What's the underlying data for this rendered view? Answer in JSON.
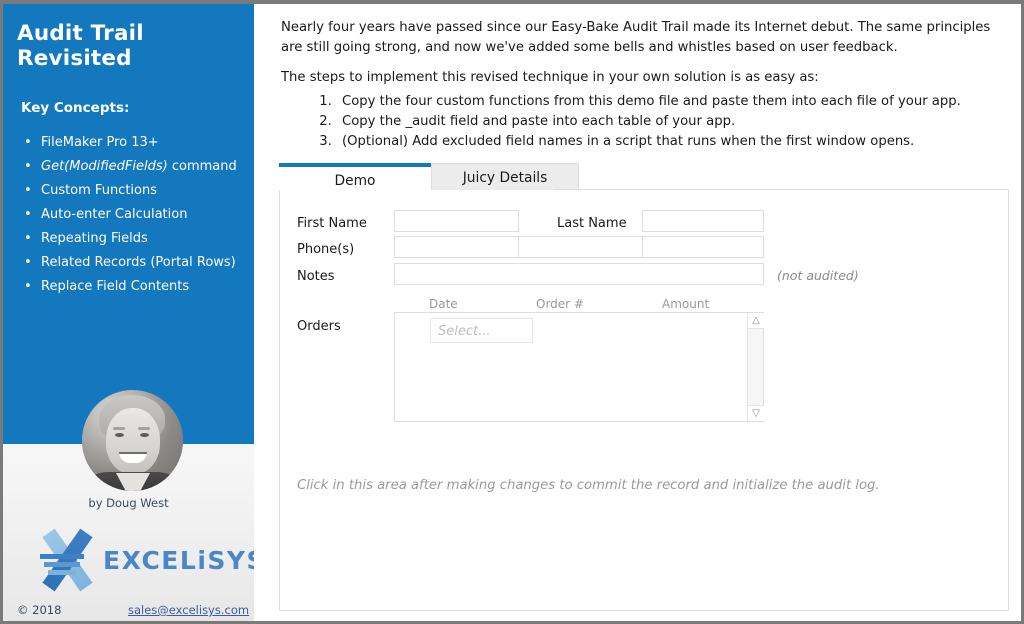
{
  "sidebar": {
    "title": "Audit Trail Revisited",
    "key_concepts_heading": "Key Concepts:",
    "concepts": [
      {
        "text": "FileMaker Pro 13+",
        "italic": ""
      },
      {
        "text": " command",
        "italic": "Get(ModifiedFields)"
      },
      {
        "text": "Custom Functions",
        "italic": ""
      },
      {
        "text": "Auto-enter Calculation",
        "italic": ""
      },
      {
        "text": "Repeating Fields",
        "italic": ""
      },
      {
        "text": "Related Records (Portal Rows)",
        "italic": ""
      },
      {
        "text": "Replace Field Contents",
        "italic": ""
      }
    ],
    "byline": "by Doug West",
    "logo_text": "EXCELiSYS",
    "copyright": "© 2018",
    "email": "sales@excelisys.com",
    "accent_color": "#1478be"
  },
  "main": {
    "intro_paragraph": "Nearly four years have passed since our Easy-Bake Audit Trail made its Internet debut. The same principles are still going strong, and now we've added some bells and whistles based on user feedback.",
    "steps_lead": "The steps to implement this revised technique in your own solution is as easy as:",
    "steps": [
      "Copy the four custom functions from this demo file and paste them into each file of your app.",
      "Copy the _audit field and paste into each table of your app.",
      "(Optional) Add excluded field names in a script that runs when the first window opens."
    ],
    "tabs": [
      {
        "label": "Demo",
        "active": true
      },
      {
        "label": "Juicy Details",
        "active": false
      }
    ],
    "form": {
      "first_name_label": "First Name",
      "first_name_value": "",
      "last_name_label": "Last Name",
      "last_name_value": "",
      "phones_label": "Phone(s)",
      "phone1_value": "",
      "phone2_value": "",
      "phone3_value": "",
      "notes_label": "Notes",
      "notes_value": "",
      "notes_annotation": "(not audited)",
      "orders_label": "Orders",
      "portal_columns": [
        "Date",
        "Order #",
        "Amount"
      ],
      "portal_select_placeholder": "Select...",
      "scroll_up_icon": "chevron-up-icon",
      "scroll_down_icon": "chevron-down-icon"
    },
    "commit_hint": "Click in this area after making changes to commit the record and initialize the audit log."
  }
}
